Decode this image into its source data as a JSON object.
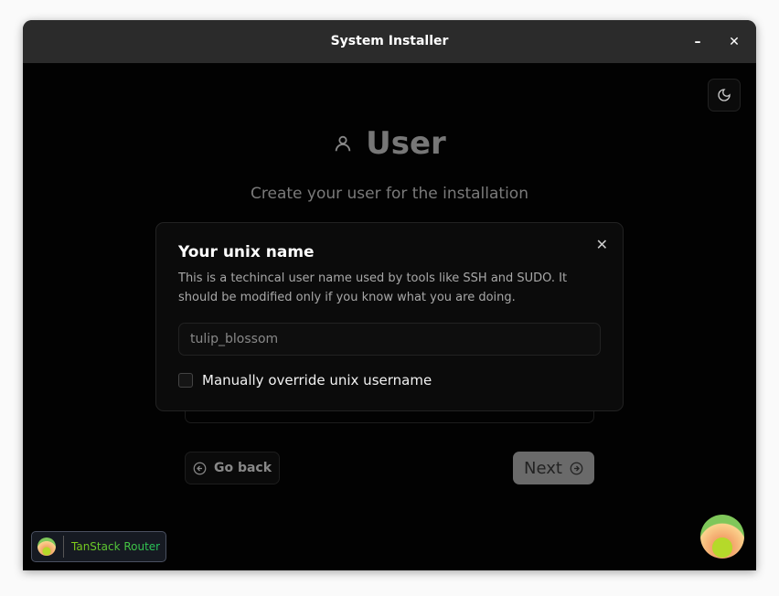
{
  "window": {
    "title": "System Installer",
    "minimize": "–",
    "close": "✕"
  },
  "page": {
    "title": "User",
    "subtitle": "Create your user for the installation"
  },
  "dialog": {
    "title": "Your unix name",
    "description": "This is a techincal user name used by tools like SSH and SUDO. It should be modified only if you know what you are doing.",
    "input_value": "tulip_blossom",
    "checkbox_label": "Manually override unix username",
    "close": "✕"
  },
  "nav": {
    "back": "Go back",
    "next": "Next"
  },
  "devtools": {
    "label": "TanStack Router"
  }
}
